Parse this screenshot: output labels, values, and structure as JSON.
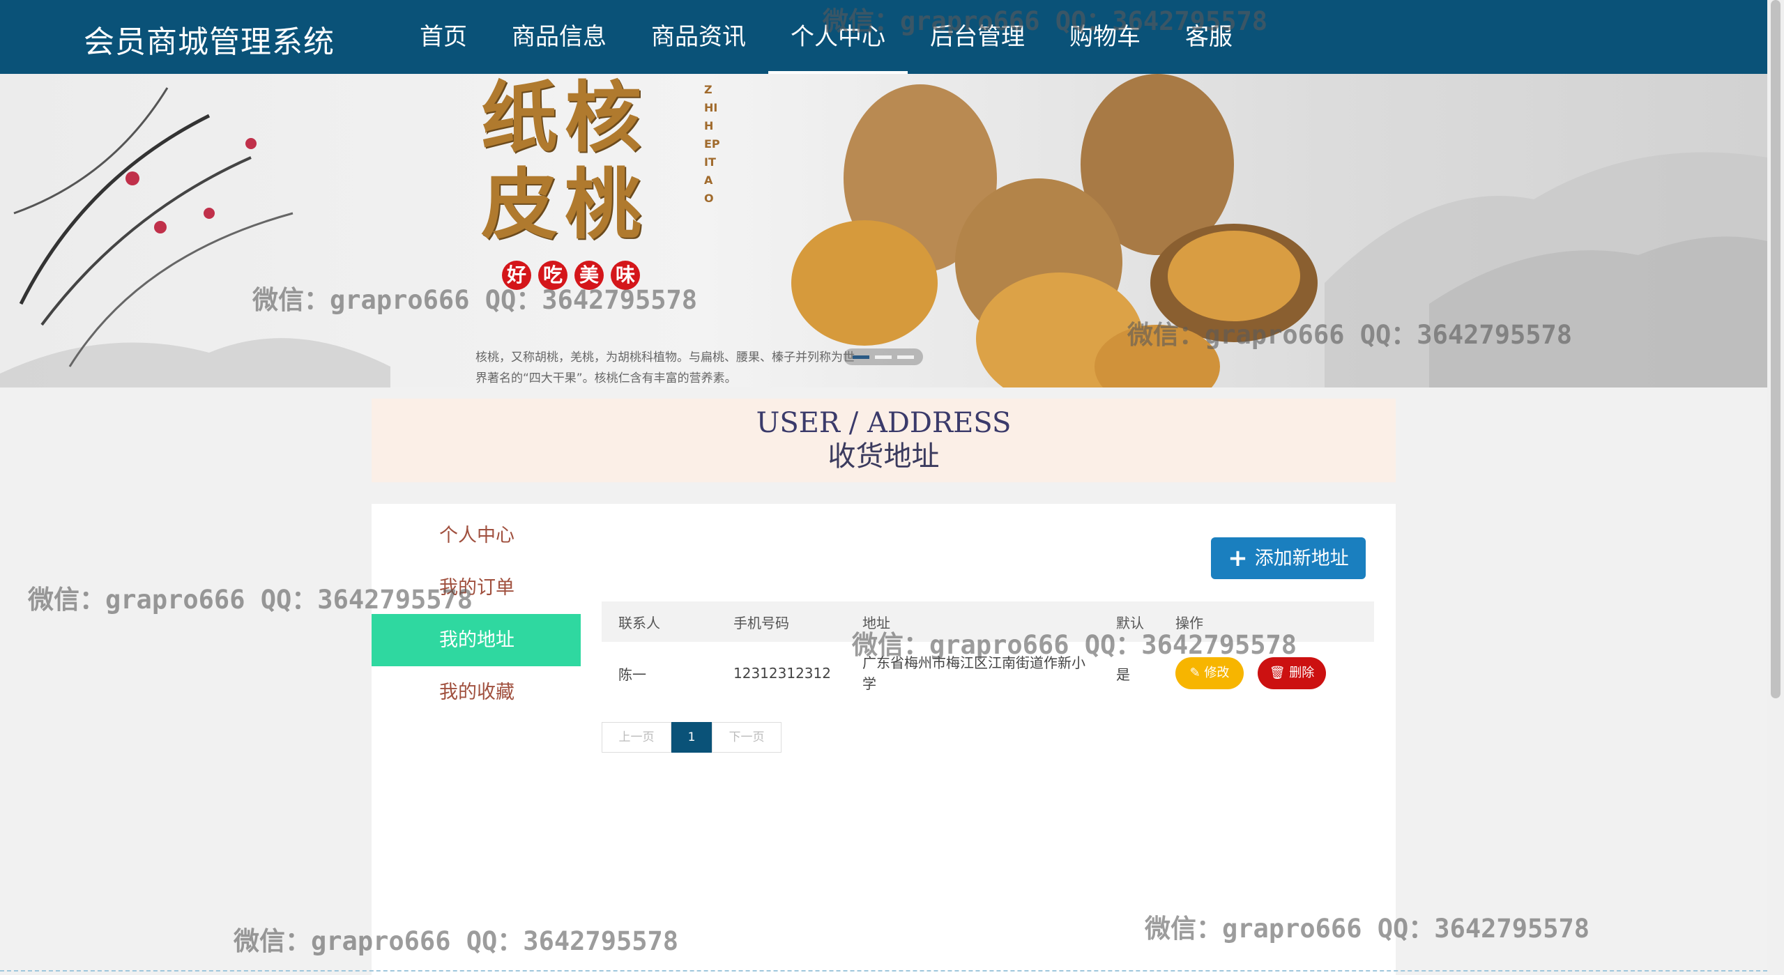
{
  "app": {
    "title": "会员商城管理系统"
  },
  "nav": {
    "items": [
      {
        "label": "首页"
      },
      {
        "label": "商品信息"
      },
      {
        "label": "商品资讯"
      },
      {
        "label": "个人中心",
        "active": true
      },
      {
        "label": "后台管理"
      },
      {
        "label": "购物车"
      },
      {
        "label": "客服"
      }
    ]
  },
  "banner": {
    "title": "纸核皮桃",
    "vertical_text": "ZHIHEPITAO",
    "tags": [
      "好",
      "吃",
      "美",
      "味"
    ],
    "description": "核桃，又称胡桃，羌桃，为胡桃科植物。与扁桃、腰果、榛子并列称为世界著名的“四大干果”。核桃仁含有丰富的营养素。",
    "slides": 3,
    "active_slide": 0
  },
  "page_header": {
    "en": "USER / ADDRESS",
    "cn": "收货地址"
  },
  "sidebar": {
    "items": [
      {
        "label": "个人中心"
      },
      {
        "label": "我的订单"
      },
      {
        "label": "我的地址",
        "active": true
      },
      {
        "label": "我的收藏"
      }
    ]
  },
  "actions": {
    "add_address": "添加新地址"
  },
  "table": {
    "headers": [
      "联系人",
      "手机号码",
      "地址",
      "默认",
      "操作"
    ],
    "rows": [
      {
        "contact": "陈一",
        "phone": "12312312312",
        "address": "广东省梅州市梅江区江南街道作新小学",
        "default": "是",
        "edit": "修改",
        "delete": "删除"
      }
    ]
  },
  "pagination": {
    "prev": "上一页",
    "current": "1",
    "next": "下一页"
  },
  "watermark": "微信：grapro666 QQ：3642795578",
  "colors": {
    "nav_bg": "#0a5278",
    "active_side": "#2fd8a0",
    "add_button": "#1a7fbf",
    "edit_button": "#f7b500",
    "delete_button": "#cc1111"
  }
}
